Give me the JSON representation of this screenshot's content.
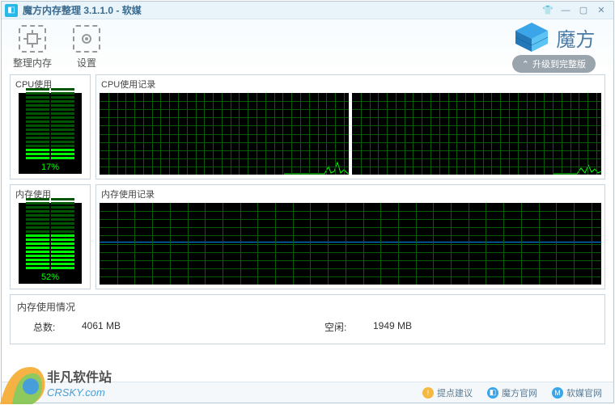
{
  "titlebar": {
    "text": "魔方内存整理 3.1.1.0 - 软媒"
  },
  "toolbar": {
    "defrag": "整理内存",
    "settings": "设置"
  },
  "brand": {
    "name": "魔方",
    "upgrade": "升级到完整版"
  },
  "cpu": {
    "usage_label": "CPU使用",
    "history_label": "CPU使用记录",
    "percent": "17%"
  },
  "mem": {
    "usage_label": "内存使用",
    "history_label": "内存使用记录",
    "percent": "52%"
  },
  "info": {
    "title": "内存使用情况",
    "total_label": "总数:",
    "total_val": "4061 MB",
    "free_label": "空闲:",
    "free_val": "1949 MB"
  },
  "status": {
    "suggest": "提点建议",
    "mofang_site": "魔方官网",
    "ruanmei_site": "软媒官网"
  },
  "watermark": {
    "line1": "非凡软件站",
    "line2": "CRSKY.com"
  },
  "chart_data": {
    "cpu_gauge": {
      "type": "gauge",
      "value": 17,
      "max": 100,
      "unit": "%"
    },
    "mem_gauge": {
      "type": "gauge",
      "value": 52,
      "max": 100,
      "unit": "%"
    },
    "cpu_history": {
      "type": "line",
      "panels": 2,
      "ylim": [
        0,
        100
      ],
      "note": "two CPU core panels; mostly ~0-2% with brief spikes near right edge up to ~30-40%"
    },
    "mem_history": {
      "type": "line",
      "ylim": [
        0,
        100
      ],
      "note": "flat line at ~52% across full width"
    }
  }
}
